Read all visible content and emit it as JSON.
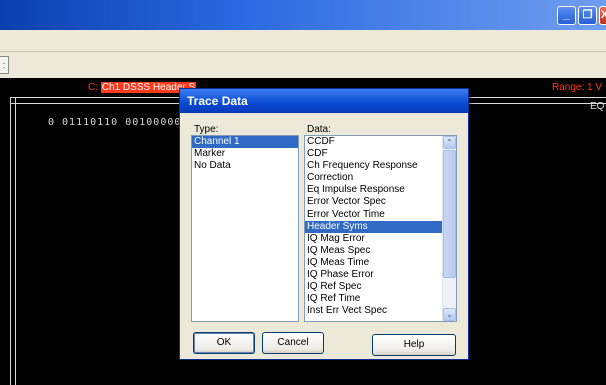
{
  "window": {
    "minimize_icon": "minimize-icon",
    "maximize_icon": "restore-icon",
    "close_icon": "close-icon",
    "minimize_glyph": "_",
    "restore_glyph": "❐",
    "close_glyph": "X"
  },
  "toolbar": {
    "stub_glyph": ":"
  },
  "trace": {
    "prefix": "C: ",
    "name": "Ch1 DSSS Header S",
    "range": "Range: 1 V",
    "eq_label": "EQ",
    "bits": "0 01110110 00100000"
  },
  "dialog": {
    "title": "Trace Data",
    "type_label": "Type:",
    "data_label": "Data:",
    "type_items": [
      "Channel 1",
      "Marker",
      "No Data"
    ],
    "type_selected": 0,
    "data_items": [
      "CCDF",
      "CDF",
      "Ch Frequency Response",
      "Correction",
      "Eq Impulse Response",
      "Error Vector Spec",
      "Error Vector Time",
      "Header Syms",
      "IQ Mag Error",
      "IQ Meas Spec",
      "IQ Meas Time",
      "IQ Phase Error",
      "IQ Ref Spec",
      "IQ Ref Time",
      "Inst Err Vect Spec"
    ],
    "data_selected": 7,
    "ok_label": "OK",
    "cancel_label": "Cancel",
    "help_label": "Help",
    "scroll_up_glyph": "⌃",
    "scroll_down_glyph": "⌄"
  }
}
